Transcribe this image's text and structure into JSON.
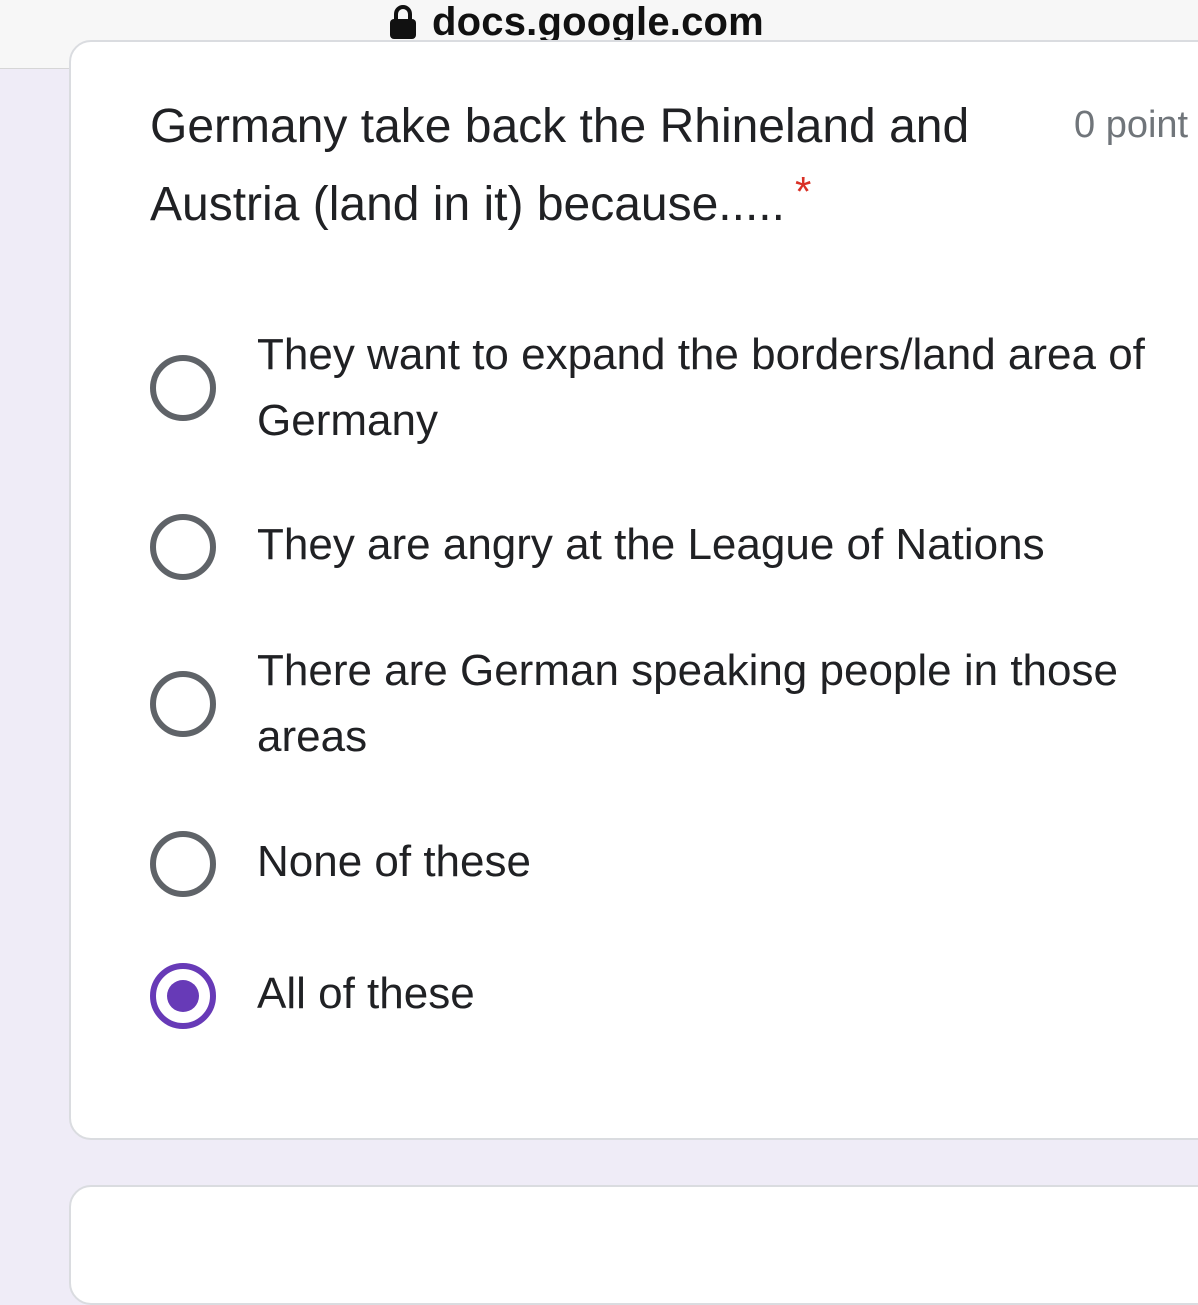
{
  "browser": {
    "url": "docs.google.com"
  },
  "question": {
    "text": "Germany take back the Rhineland and Austria (land in it) because.....",
    "required_marker": "*",
    "points": "0 point"
  },
  "options": [
    {
      "label": "They want to expand the borders/land area of Germany",
      "selected": false
    },
    {
      "label": "They are angry at the League of Nations",
      "selected": false
    },
    {
      "label": "There are German speaking people in those areas",
      "selected": false
    },
    {
      "label": "None of these",
      "selected": false
    },
    {
      "label": "All of these",
      "selected": true
    }
  ],
  "colors": {
    "accent": "#673ab7",
    "required": "#d93025",
    "background": "#efecf7"
  },
  "icons": {
    "url_bar": "lock-icon"
  }
}
